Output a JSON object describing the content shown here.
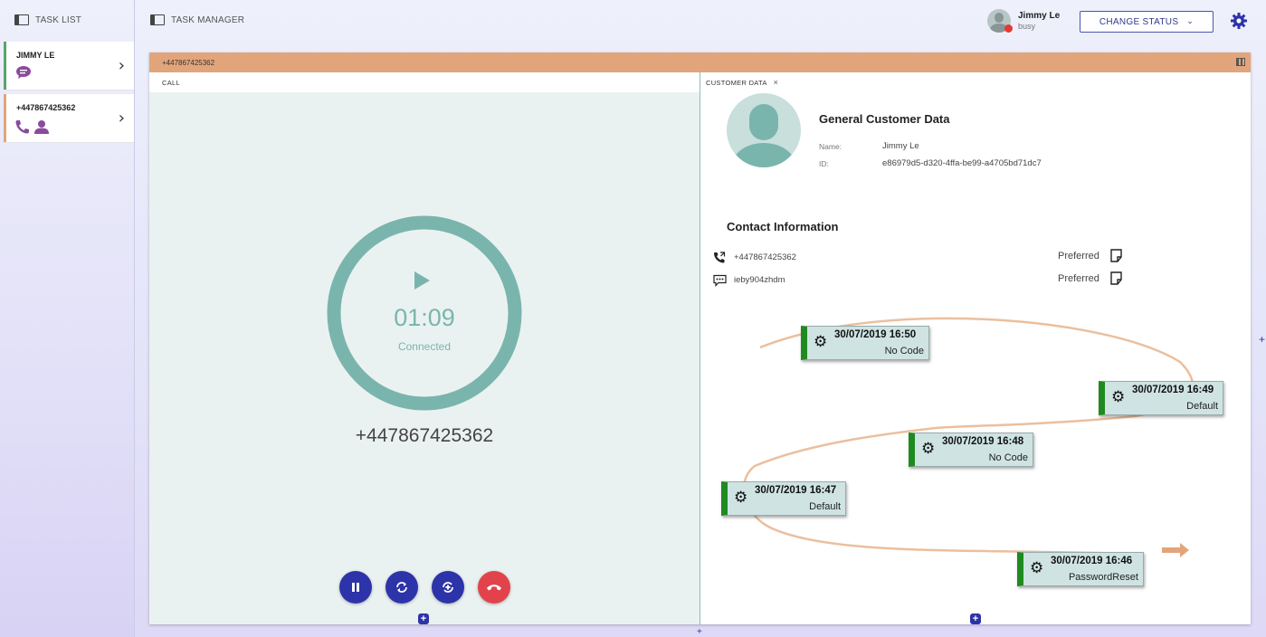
{
  "tasklist": {
    "header": "TASK LIST",
    "tasks": [
      {
        "title": "JIMMY LE",
        "stripe_color": "#5aa36a"
      },
      {
        "title": "+447867425362",
        "stripe_color": "#e2a57b"
      }
    ]
  },
  "header": {
    "title": "TASK MANAGER",
    "user_name": "Jimmy Le",
    "user_status": "busy",
    "change_status_label": "CHANGE STATUS"
  },
  "task_window": {
    "title": "+447867425362",
    "call_pane": {
      "label": "CALL",
      "timer": "01:09",
      "state": "Connected",
      "number": "+447867425362"
    },
    "customer_pane": {
      "tab_label": "CUSTOMER DATA",
      "general_title": "General Customer Data",
      "name_label": "Name:",
      "name_value": "Jimmy Le",
      "id_label": "ID:",
      "id_value": "e86979d5-d320-4ffa-be99-a4705bd71dc7",
      "contact_title": "Contact Information",
      "contacts": [
        {
          "value": "+447867425362",
          "tag": "Preferred",
          "icon": "phone-icon"
        },
        {
          "value": "ieby904zhdm",
          "tag": "Preferred",
          "icon": "chat-icon"
        }
      ],
      "timeline": [
        {
          "date": "30/07/2019 16:50",
          "code": "No Code"
        },
        {
          "date": "30/07/2019 16:49",
          "code": "Default"
        },
        {
          "date": "30/07/2019 16:48",
          "code": "No Code"
        },
        {
          "date": "30/07/2019 16:47",
          "code": "Default"
        },
        {
          "date": "30/07/2019 16:46",
          "code": "PasswordReset"
        }
      ]
    }
  },
  "colors": {
    "accent": "#2d33a8",
    "window_bar": "#e2a57b",
    "teal": "#7ab5ad",
    "hangup": "#e2434b",
    "status_busy": "#e53935"
  }
}
